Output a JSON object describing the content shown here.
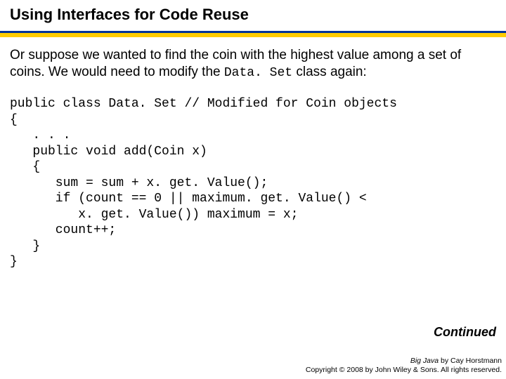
{
  "title": "Using Interfaces for Code Reuse",
  "para": {
    "part1": "Or suppose we wanted to find the coin with the highest value among a set of coins. We would need to modify the ",
    "code": "Data. Set",
    "part2": " class again:"
  },
  "code": {
    "l1": "public class Data. Set // Modified for Coin objects",
    "l2": "{",
    "l3": "   . . .",
    "l4": "   public void add(Coin x)",
    "l5": "   {",
    "l6": "      sum = sum + x. get. Value();",
    "l7": "      if (count == 0 || maximum. get. Value() <",
    "l8": "         x. get. Value()) maximum = x;",
    "l9": "      count++;",
    "l10": "   }",
    "l11": "}"
  },
  "continued": "Continued",
  "footer": {
    "book": "Big Java",
    "author": " by Cay Horstmann",
    "copyright": "Copyright © 2008 by John Wiley & Sons. All rights reserved."
  }
}
